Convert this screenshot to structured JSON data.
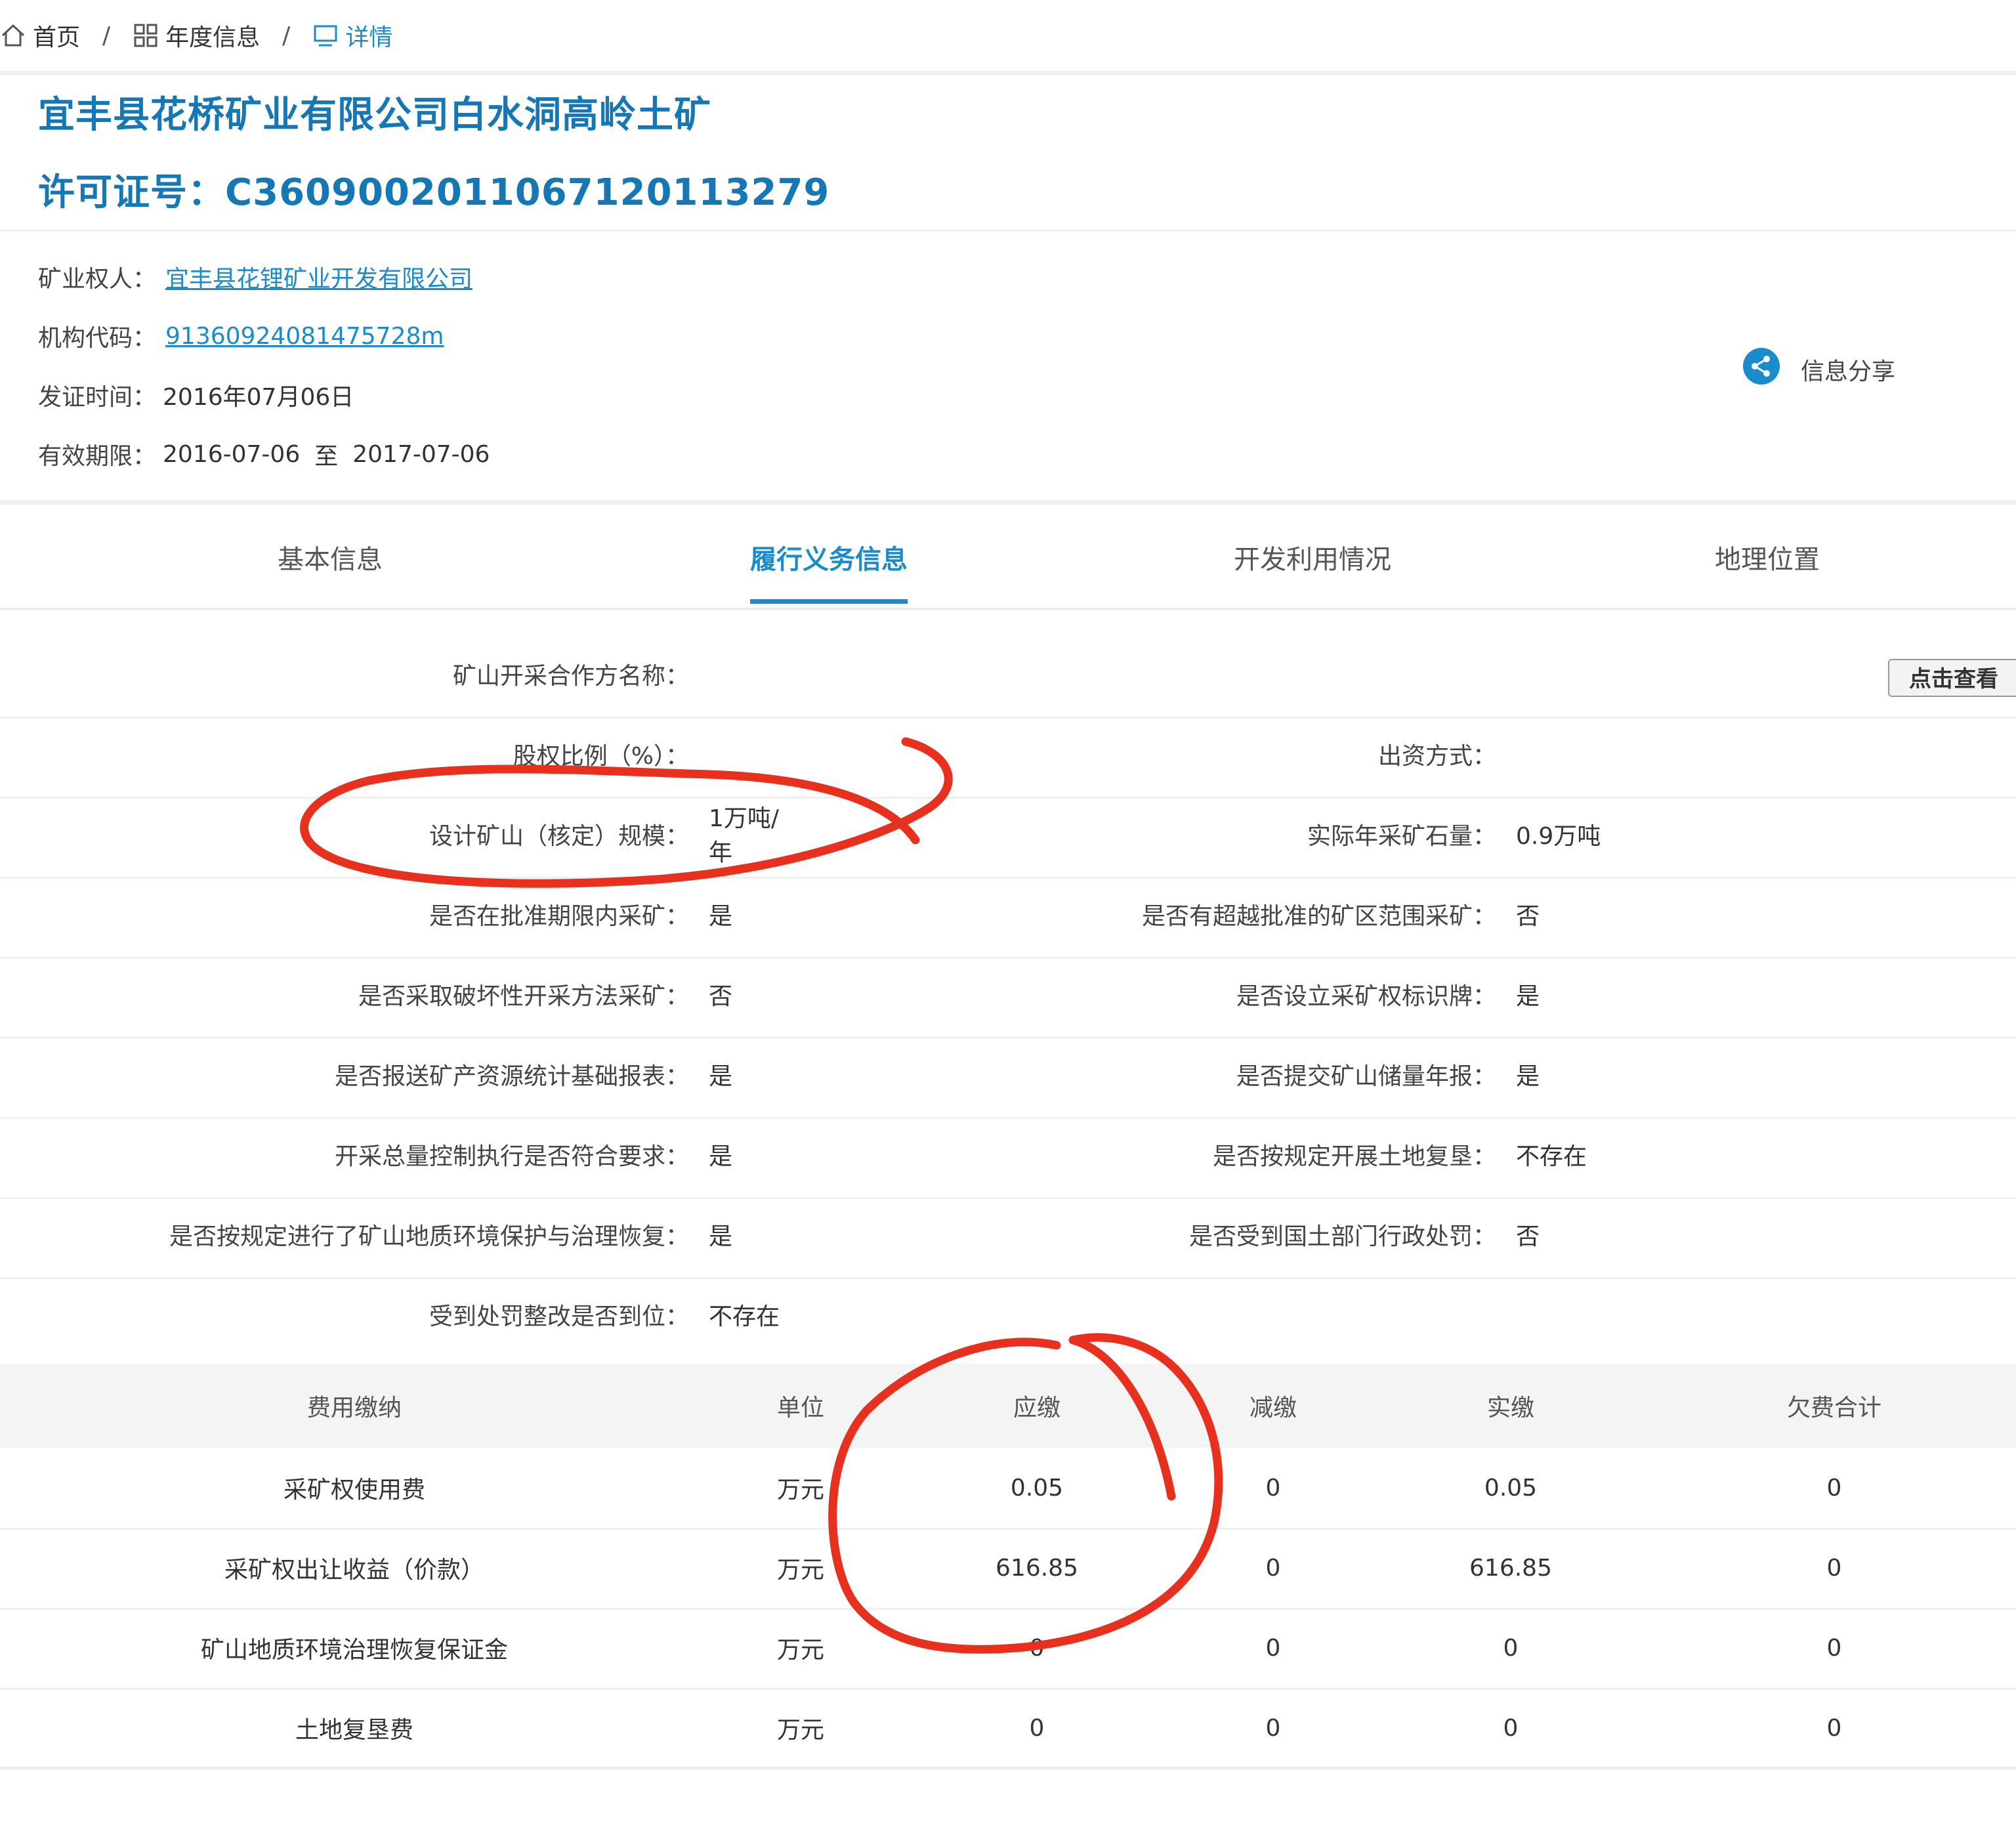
{
  "breadcrumb": {
    "home": "首页",
    "annual": "年度信息",
    "detail": "详情"
  },
  "header": {
    "company_title": "宜丰县花桥矿业有限公司白水洞高岭土矿",
    "license_label": "许可证号：",
    "license_no": "C3609002011067120113279"
  },
  "info": {
    "owner_label": "矿业权人：",
    "owner_value": "宜丰县花锂矿业开发有限公司",
    "code_label": "机构代码：",
    "code_value": "91360924081475728m",
    "issue_label": "发证时间：",
    "issue_value": "2016年07月06日",
    "validity_label": "有效期限：",
    "validity_from": "2016-07-06",
    "validity_to_word": "至",
    "validity_to": "2017-07-06",
    "share_label": "信息分享"
  },
  "tabs": {
    "basic": "基本信息",
    "duty": "履行义务信息",
    "develop": "开发利用情况",
    "location": "地理位置"
  },
  "accent_color": "#1a8ccc",
  "annotation_color": "#e8301e",
  "duty_rows": [
    {
      "ll": "矿山开采合作方名称：",
      "lv": "",
      "rl": "",
      "rv": ""
    },
    {
      "ll": "股权比例（%）：",
      "lv": "",
      "rl": "出资方式：",
      "rv": ""
    },
    {
      "ll": "设计矿山（核定）规模：",
      "lv": "1万吨/年",
      "rl": "实际年采矿石量：",
      "rv": "0.9万吨"
    },
    {
      "ll": "是否在批准期限内采矿：",
      "lv": "是",
      "rl": "是否有超越批准的矿区范围采矿：",
      "rv": "否"
    },
    {
      "ll": "是否采取破坏性开采方法采矿：",
      "lv": "否",
      "rl": "是否设立采矿权标识牌：",
      "rv": "是"
    },
    {
      "ll": "是否报送矿产资源统计基础报表：",
      "lv": "是",
      "rl": "是否提交矿山储量年报：",
      "rv": "是"
    },
    {
      "ll": "开采总量控制执行是否符合要求：",
      "lv": "是",
      "rl": "是否按规定开展土地复垦：",
      "rv": "不存在"
    },
    {
      "ll": "是否按规定进行了矿山地质环境保护与治理恢复：",
      "lv": "是",
      "rl": "是否受到国土部门行政处罚：",
      "rv": "否"
    },
    {
      "ll": "受到处罚整改是否到位：",
      "lv": "不存在",
      "rl": "",
      "rv": ""
    }
  ],
  "view_button": "点击查看",
  "fee_table": {
    "headers": [
      "费用缴纳",
      "单位",
      "应缴",
      "减缴",
      "实缴",
      "欠费合计"
    ],
    "rows": [
      [
        "采矿权使用费",
        "万元",
        "0.05",
        "0",
        "0.05",
        "0"
      ],
      [
        "采矿权出让收益（价款）",
        "万元",
        "616.85",
        "0",
        "616.85",
        "0"
      ],
      [
        "矿山地质环境治理恢复保证金",
        "万元",
        "0",
        "0",
        "0",
        "0"
      ],
      [
        "土地复垦费",
        "万元",
        "0",
        "0",
        "0",
        "0"
      ]
    ]
  }
}
